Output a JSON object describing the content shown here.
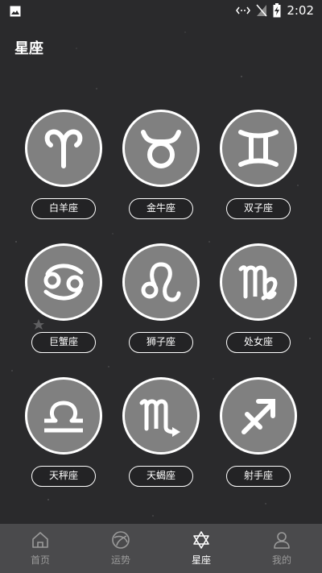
{
  "status_bar": {
    "time": "2:02"
  },
  "page": {
    "title": "星座"
  },
  "zodiac": [
    {
      "name": "白羊座",
      "icon": "aries-icon"
    },
    {
      "name": "金牛座",
      "icon": "taurus-icon"
    },
    {
      "name": "双子座",
      "icon": "gemini-icon"
    },
    {
      "name": "巨蟹座",
      "icon": "cancer-icon"
    },
    {
      "name": "狮子座",
      "icon": "leo-icon"
    },
    {
      "name": "处女座",
      "icon": "virgo-icon"
    },
    {
      "name": "天秤座",
      "icon": "libra-icon"
    },
    {
      "name": "天蝎座",
      "icon": "scorpio-icon"
    },
    {
      "name": "射手座",
      "icon": "sagittarius-icon"
    }
  ],
  "bottom_nav": [
    {
      "label": "首页",
      "icon": "home-icon",
      "active": false
    },
    {
      "label": "运势",
      "icon": "fortune-icon",
      "active": false
    },
    {
      "label": "星座",
      "icon": "star-of-david-icon",
      "active": true
    },
    {
      "label": "我的",
      "icon": "user-icon",
      "active": false
    }
  ]
}
